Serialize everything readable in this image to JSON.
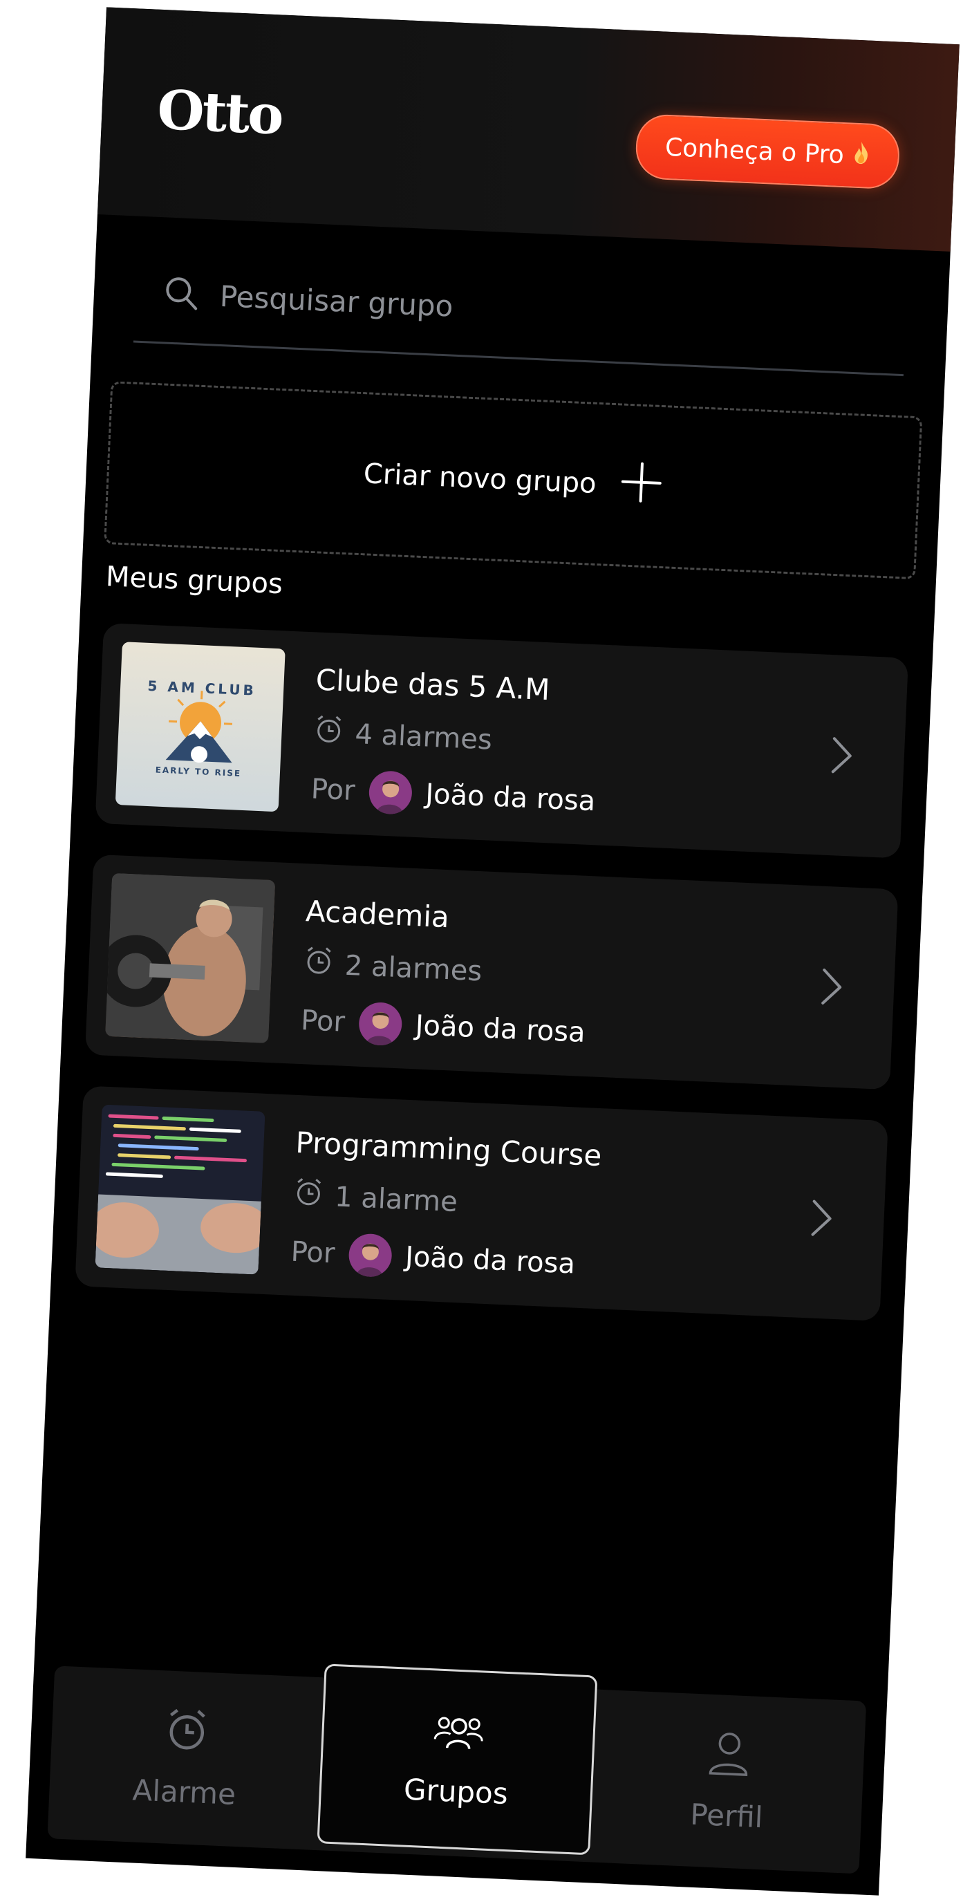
{
  "app": {
    "logo": "Otto"
  },
  "header": {
    "pro_button_label": "Conheça o Pro"
  },
  "search": {
    "placeholder": "Pesquisar grupo"
  },
  "create_group": {
    "label": "Criar novo grupo"
  },
  "section": {
    "title": "Meus grupos"
  },
  "groups": [
    {
      "title": "Clube das 5 A.M",
      "alarms": "4 alarmes",
      "by_label": "Por",
      "author": "João  da rosa",
      "image_text": {
        "top": "5 AM CLUB",
        "bottom": "EARLY TO RISE"
      }
    },
    {
      "title": "Academia",
      "alarms": "2 alarmes",
      "by_label": "Por",
      "author": "João  da rosa"
    },
    {
      "title": "Programming Course",
      "alarms": "1 alarme",
      "by_label": "Por",
      "author": "João  da rosa"
    }
  ],
  "nav": {
    "items": [
      {
        "label": "Alarme",
        "icon": "alarm-clock-icon",
        "active": false
      },
      {
        "label": "Grupos",
        "icon": "group-icon",
        "active": true
      },
      {
        "label": "Perfil",
        "icon": "user-icon",
        "active": false
      }
    ]
  },
  "colors": {
    "accent": "#f2321a",
    "background": "#000000",
    "card": "#141414",
    "muted": "#8d9096"
  }
}
